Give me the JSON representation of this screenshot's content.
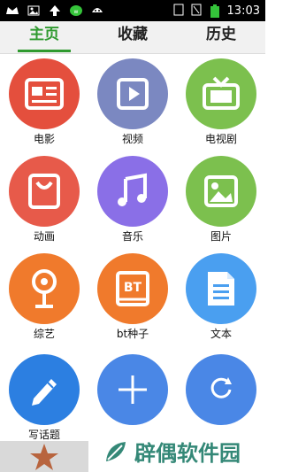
{
  "status_bar": {
    "time": "13:03",
    "icons_left": [
      "crown-icon",
      "image-icon",
      "upload-arrow-icon",
      "wechat-icon",
      "android-icon"
    ],
    "icons_right": [
      "sim-icon",
      "nosignal-icon",
      "battery-icon"
    ]
  },
  "tabs": [
    {
      "label": "主页",
      "active": true
    },
    {
      "label": "收藏",
      "active": false
    },
    {
      "label": "历史",
      "active": false
    }
  ],
  "tiles": [
    {
      "label": "电影",
      "icon": "newspaper-icon",
      "color": "#e44f3d"
    },
    {
      "label": "视频",
      "icon": "video-player-icon",
      "color": "#7b88c1"
    },
    {
      "label": "电视剧",
      "icon": "tv-icon",
      "color": "#7cc04e"
    },
    {
      "label": "动画",
      "icon": "bag-icon",
      "color": "#e75a4a"
    },
    {
      "label": "音乐",
      "icon": "music-note-icon",
      "color": "#8a6fe7"
    },
    {
      "label": "图片",
      "icon": "image-icon",
      "color": "#7cc04e"
    },
    {
      "label": "综艺",
      "icon": "camera-stand-icon",
      "color": "#f07a2c"
    },
    {
      "label": "bt种子",
      "icon": "bt-book-icon",
      "color": "#f07a2c"
    },
    {
      "label": "文本",
      "icon": "document-icon",
      "color": "#4a9ff0"
    },
    {
      "label": "写话题",
      "icon": "pencil-icon",
      "color": "#2c7fe1"
    },
    {
      "label": "",
      "icon": "plus-icon",
      "color": "#4a87e6"
    },
    {
      "label": "",
      "icon": "refresh-icon",
      "color": "#4a87e6"
    }
  ],
  "bottom_nav": {
    "icon": "star-icon",
    "color": "#b8643e"
  },
  "watermark": {
    "text": "辟偶软件园"
  }
}
